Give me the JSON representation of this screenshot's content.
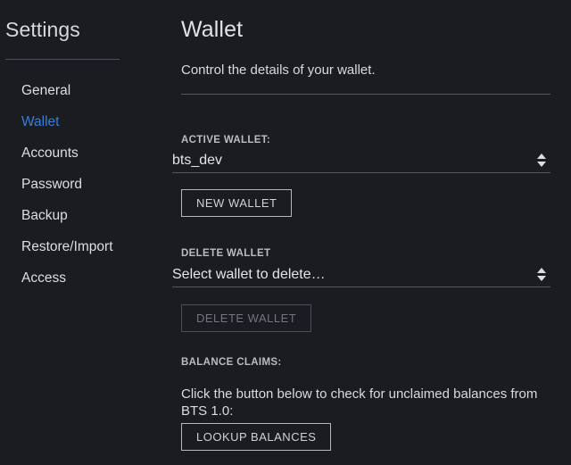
{
  "sidebar": {
    "title": "Settings",
    "items": [
      {
        "label": "General",
        "active": false
      },
      {
        "label": "Wallet",
        "active": true
      },
      {
        "label": "Accounts",
        "active": false
      },
      {
        "label": "Password",
        "active": false
      },
      {
        "label": "Backup",
        "active": false
      },
      {
        "label": "Restore/Import",
        "active": false
      },
      {
        "label": "Access",
        "active": false
      }
    ]
  },
  "main": {
    "title": "Wallet",
    "description": "Control the details of your wallet.",
    "active_wallet": {
      "label": "ACTIVE WALLET:",
      "selected": "bts_dev",
      "new_wallet_button": "NEW WALLET"
    },
    "delete_wallet": {
      "label": "DELETE WALLET",
      "selected": "Select wallet to delete…",
      "delete_button": "DELETE WALLET",
      "delete_button_disabled": true
    },
    "balance_claims": {
      "label": "BALANCE CLAIMS:",
      "description": "Click the button below to check for unclaimed balances from BTS 1.0:",
      "lookup_button": "LOOKUP BALANCES"
    }
  },
  "colors": {
    "background": "#1a1c21",
    "accent": "#3a7fd5",
    "text": "#d9dbde",
    "muted": "#b9bcc1",
    "divider": "#53565d",
    "disabled": "#72757d"
  }
}
